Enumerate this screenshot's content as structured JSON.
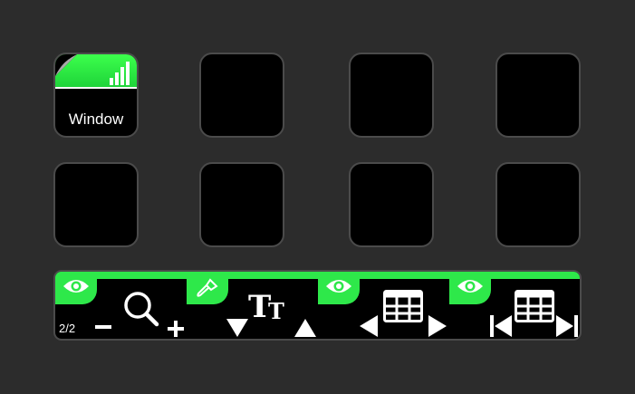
{
  "keys": [
    {
      "name": "key-1",
      "label": "Window",
      "icon": "window-app-icon"
    },
    {
      "name": "key-2",
      "label": ""
    },
    {
      "name": "key-3",
      "label": ""
    },
    {
      "name": "key-4",
      "label": ""
    },
    {
      "name": "key-5",
      "label": ""
    },
    {
      "name": "key-6",
      "label": ""
    },
    {
      "name": "key-7",
      "label": ""
    },
    {
      "name": "key-8",
      "label": ""
    }
  ],
  "dials": {
    "page_label": "2/2",
    "items": [
      {
        "name": "zoom-dial",
        "tab_icon": "eye-icon",
        "controls": [
          "minus-icon",
          "magnifier-icon",
          "plus-icon"
        ]
      },
      {
        "name": "font-size-dial",
        "tab_icon": "brush-icon",
        "controls": [
          "triangle-down-icon",
          "text-size-icon",
          "triangle-up-icon"
        ]
      },
      {
        "name": "table-nav-dial",
        "tab_icon": "eye-icon",
        "controls": [
          "triangle-left-icon",
          "table-icon",
          "triangle-right-icon"
        ]
      },
      {
        "name": "table-jump-dial",
        "tab_icon": "eye-icon",
        "controls": [
          "skip-start-icon",
          "table-icon",
          "skip-end-icon"
        ]
      }
    ]
  },
  "colors": {
    "accent": "#2ee84a",
    "background": "#2c2c2c",
    "key": "#000000",
    "border": "#4b4b4b"
  }
}
